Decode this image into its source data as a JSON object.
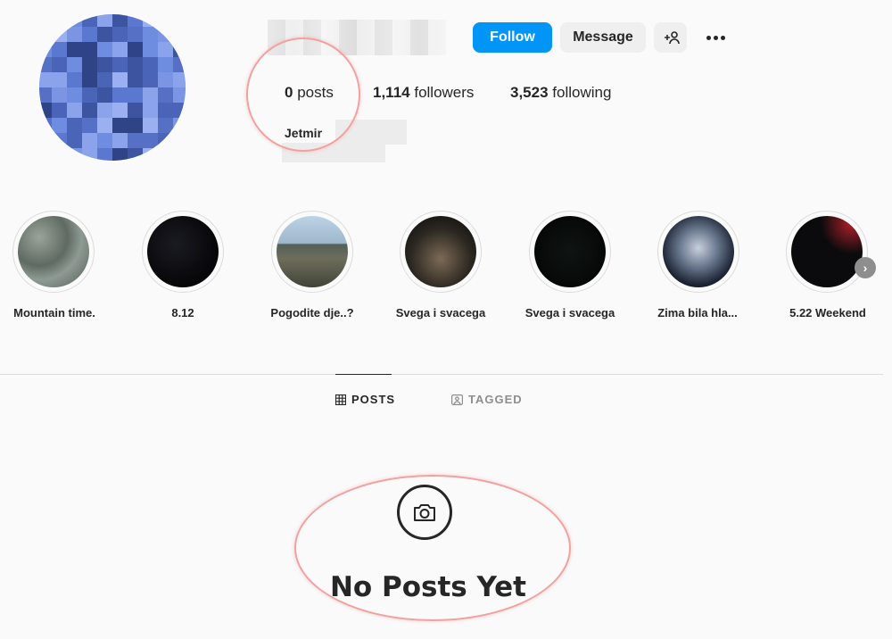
{
  "profile": {
    "follow_label": "Follow",
    "message_label": "Message",
    "suggest_icon": "add-person-icon",
    "more_icon": "ellipsis-icon",
    "full_name": "Jetmir"
  },
  "stats": {
    "posts_count": "0",
    "posts_label": "posts",
    "followers_count": "1,114",
    "followers_label": "followers",
    "following_count": "3,523",
    "following_label": "following"
  },
  "highlights": [
    {
      "label": "Mountain time."
    },
    {
      "label": "8.12"
    },
    {
      "label": "Pogodite dje..?"
    },
    {
      "label": "Svega i svacega"
    },
    {
      "label": "Svega i svacega"
    },
    {
      "label": "Zima bila hla..."
    },
    {
      "label": "5.22 Weekend"
    }
  ],
  "tabs": [
    {
      "label": "POSTS",
      "icon": "grid-icon",
      "active": true
    },
    {
      "label": "TAGGED",
      "icon": "tagged-portrait-icon",
      "active": false
    }
  ],
  "empty_state": {
    "icon": "camera-icon",
    "title": "No Posts Yet"
  },
  "colors": {
    "accent": "#0095f6",
    "annotation": "#f2a0a0",
    "text": "#262626",
    "muted": "#8e8e8e"
  }
}
